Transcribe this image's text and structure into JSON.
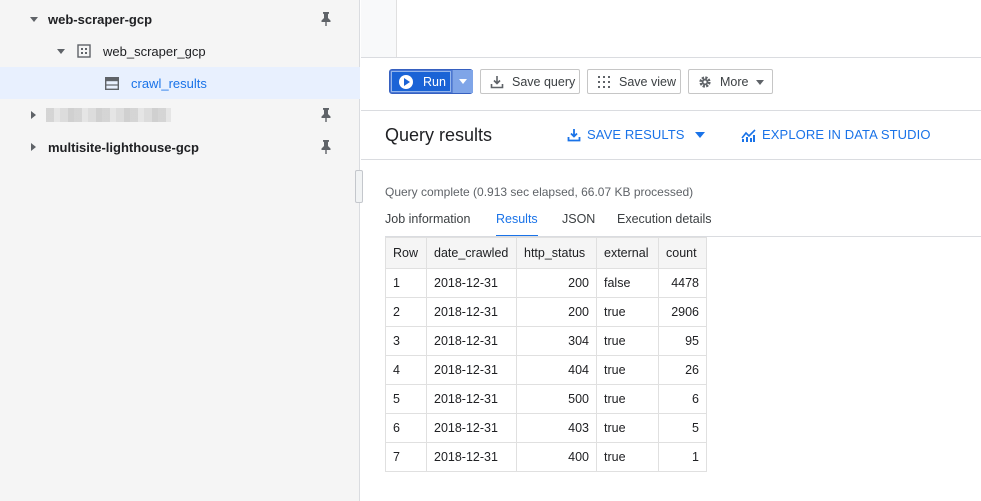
{
  "sidebar": {
    "projects": [
      {
        "name": "web-scraper-gcp",
        "expanded": true
      },
      {
        "name": "",
        "expanded": false,
        "redacted": true
      },
      {
        "name": "multisite-lighthouse-gcp",
        "expanded": false
      }
    ],
    "dataset": {
      "name": "web_scraper_gcp"
    },
    "table": {
      "name": "crawl_results"
    }
  },
  "toolbar": {
    "run_label": "Run",
    "save_query_label": "Save query",
    "save_view_label": "Save view",
    "more_label": "More"
  },
  "results": {
    "title": "Query results",
    "save_results_label": "SAVE RESULTS",
    "explore_label": "EXPLORE IN DATA STUDIO",
    "status": "Query complete (0.913 sec elapsed, 66.07 KB processed)",
    "tabs": [
      "Job information",
      "Results",
      "JSON",
      "Execution details"
    ],
    "active_tab": "Results",
    "columns": [
      "Row",
      "date_crawled",
      "http_status",
      "external",
      "count"
    ],
    "rows": [
      {
        "row": "1",
        "date_crawled": "2018-12-31",
        "http_status": "200",
        "external": "false",
        "count": "4478"
      },
      {
        "row": "2",
        "date_crawled": "2018-12-31",
        "http_status": "200",
        "external": "true",
        "count": "2906"
      },
      {
        "row": "3",
        "date_crawled": "2018-12-31",
        "http_status": "304",
        "external": "true",
        "count": "95"
      },
      {
        "row": "4",
        "date_crawled": "2018-12-31",
        "http_status": "404",
        "external": "true",
        "count": "26"
      },
      {
        "row": "5",
        "date_crawled": "2018-12-31",
        "http_status": "500",
        "external": "true",
        "count": "6"
      },
      {
        "row": "6",
        "date_crawled": "2018-12-31",
        "http_status": "403",
        "external": "true",
        "count": "5"
      },
      {
        "row": "7",
        "date_crawled": "2018-12-31",
        "http_status": "400",
        "external": "true",
        "count": "1"
      }
    ]
  },
  "colors": {
    "accent": "#1a73e8",
    "run_button": "#1a63d6",
    "sidebar_bg": "#f5f5f5",
    "selected_bg": "#e8f0fe"
  }
}
